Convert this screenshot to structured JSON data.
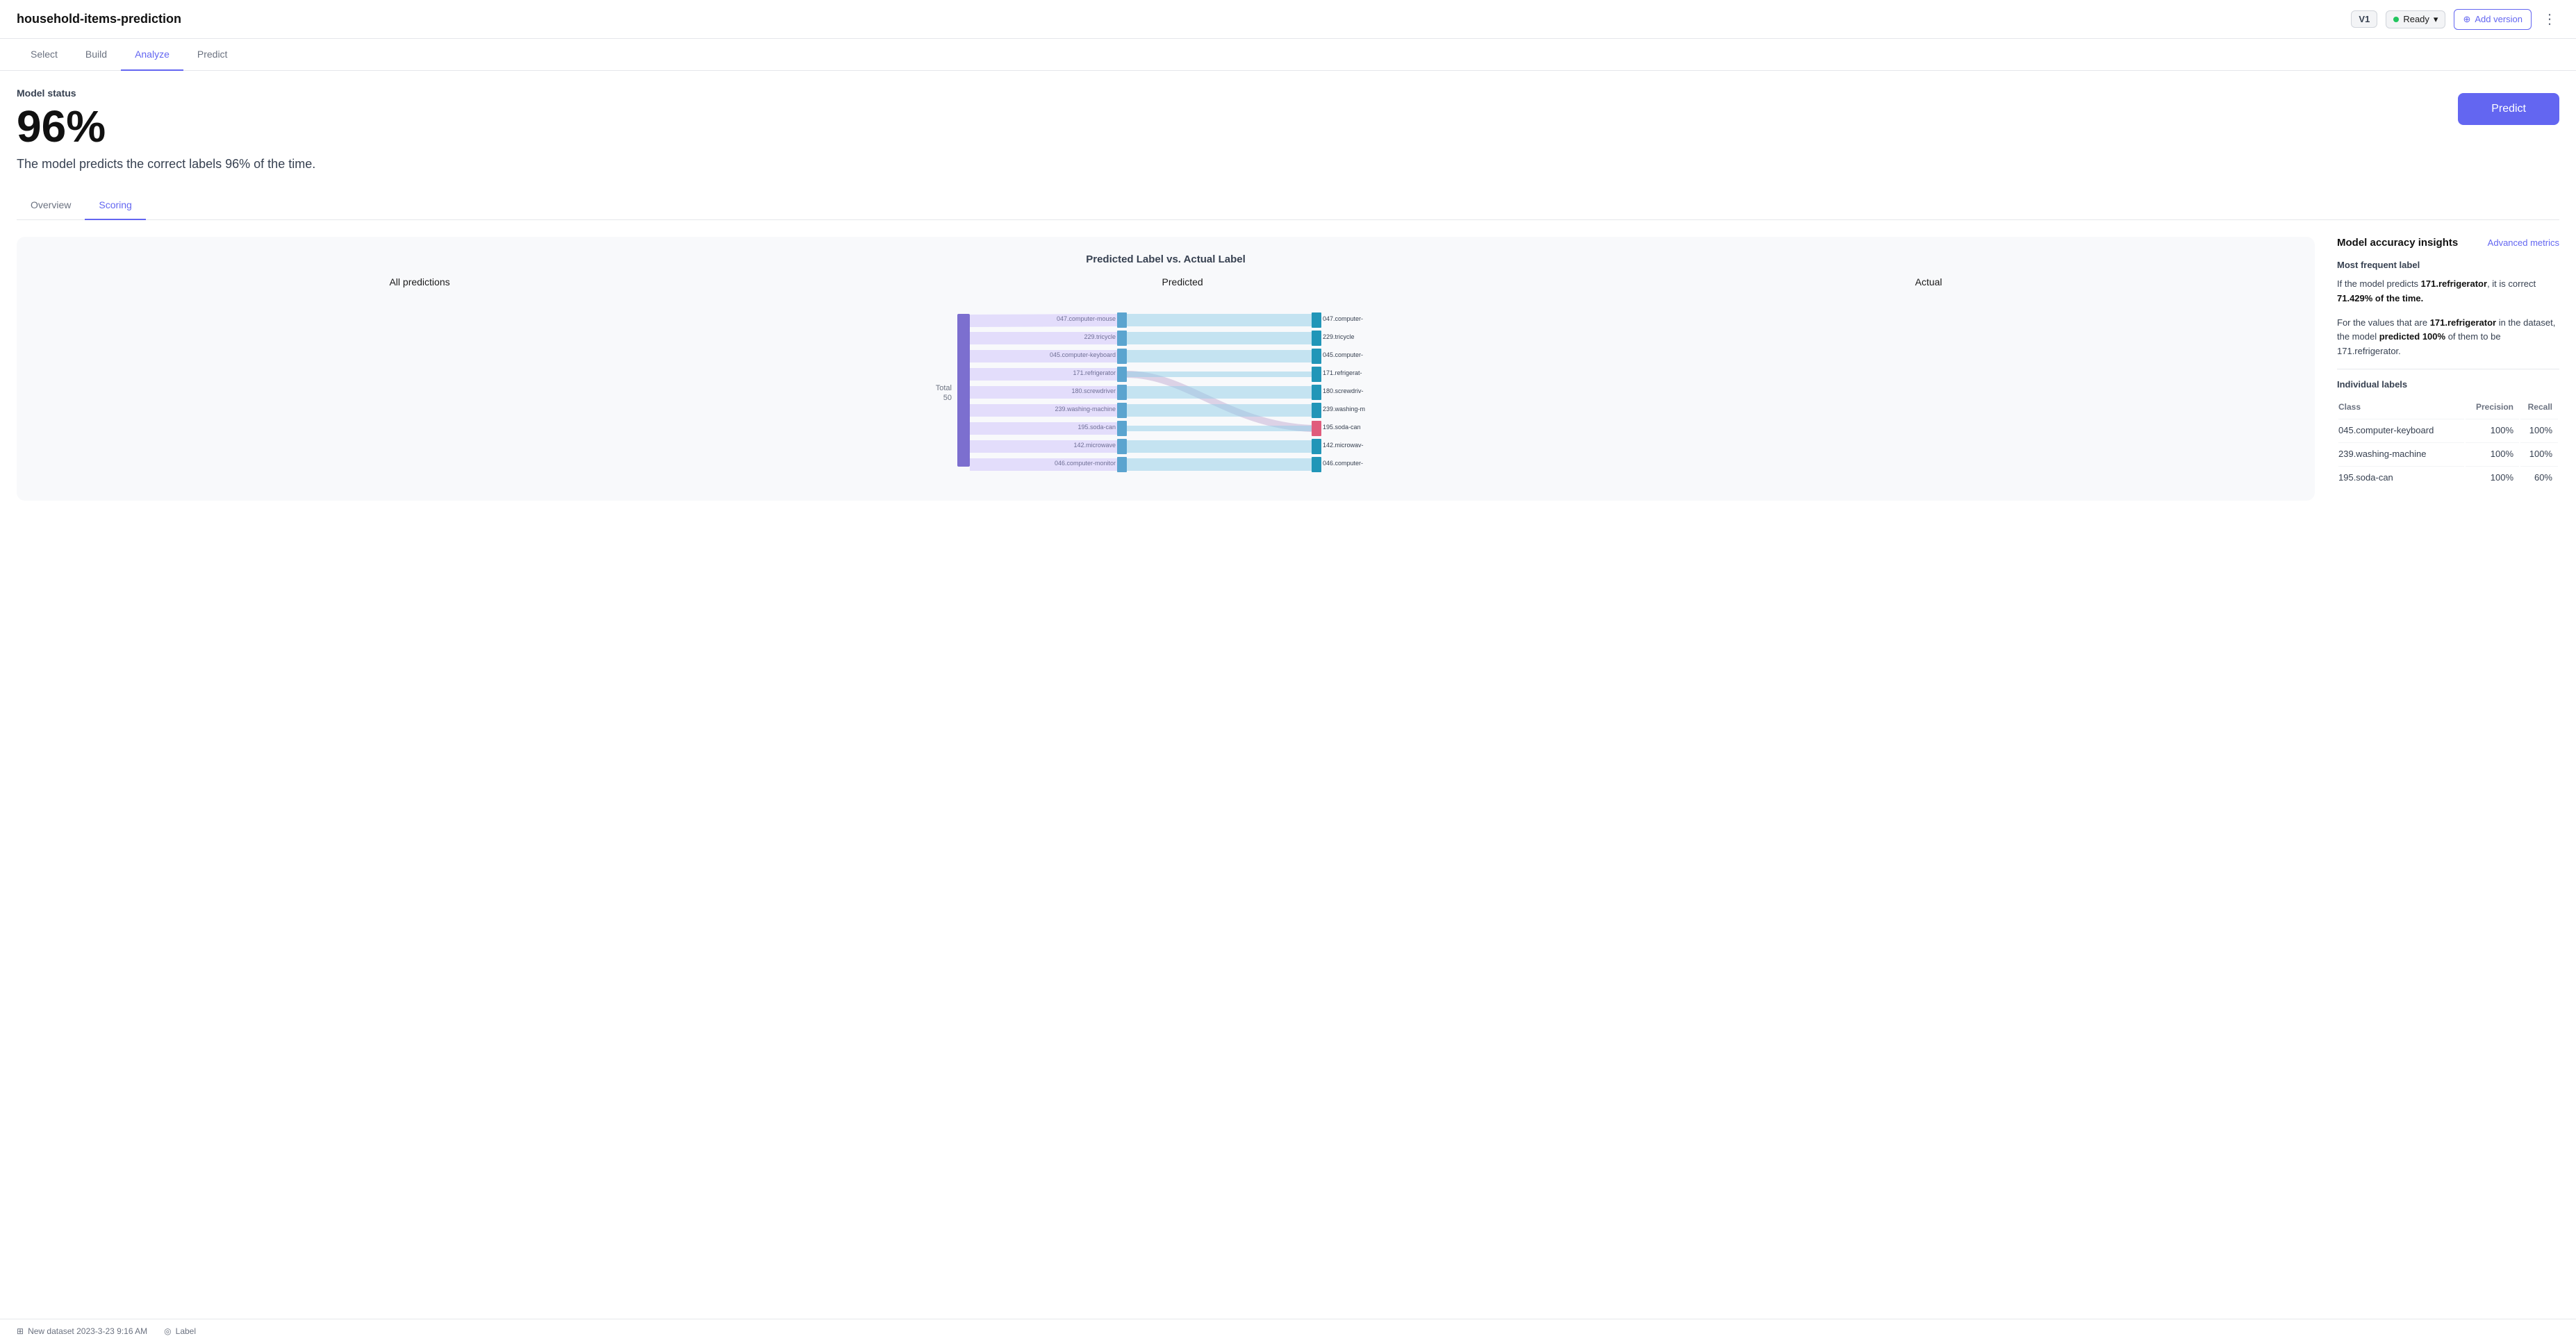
{
  "app": {
    "title": "household-items-prediction"
  },
  "header": {
    "version": "V1",
    "status": "Ready",
    "add_version_label": "Add version",
    "more_icon": "⋮"
  },
  "nav": {
    "tabs": [
      {
        "id": "select",
        "label": "Select"
      },
      {
        "id": "build",
        "label": "Build"
      },
      {
        "id": "analyze",
        "label": "Analyze",
        "active": true
      },
      {
        "id": "predict",
        "label": "Predict"
      }
    ]
  },
  "model_status": {
    "label": "Model status",
    "accuracy": "96%",
    "description": "The model predicts the correct labels 96% of the time."
  },
  "predict_button": "Predict",
  "sub_tabs": [
    {
      "id": "overview",
      "label": "Overview"
    },
    {
      "id": "scoring",
      "label": "Scoring",
      "active": true
    }
  ],
  "chart": {
    "title": "Predicted Label vs. Actual Label",
    "col_all": "All predictions",
    "col_predicted": "Predicted",
    "col_actual": "Actual",
    "total_label": "Total",
    "total_value": "50",
    "rows": [
      {
        "label": "047.computer-mouse",
        "actual": "047.computer-"
      },
      {
        "label": "229.tricycle",
        "actual": "229.tricycle"
      },
      {
        "label": "045.computer-keyboard",
        "actual": "045.computer-"
      },
      {
        "label": "171.refrigerator",
        "actual": "171.refrigerat-"
      },
      {
        "label": "180.screwdriver",
        "actual": "180.screwdriv-"
      },
      {
        "label": "239.washing-machine",
        "actual": "239.washing-m"
      },
      {
        "label": "195.soda-can",
        "actual": "195.soda-can"
      },
      {
        "label": "142.microwave",
        "actual": "142.microwav-"
      },
      {
        "label": "046.computer-monitor",
        "actual": "046.computer-"
      }
    ]
  },
  "insights": {
    "title": "Model accuracy insights",
    "advanced_metrics": "Advanced metrics",
    "most_frequent_label": "Most frequent label",
    "insight1": "If the model predicts 171.refrigerator, it is correct 71.429% of the time.",
    "insight1_bold_class": "171.refrigerator",
    "insight1_bold_pct": "71.429% of the time.",
    "insight2_pre": "For the values that are",
    "insight2_class": "171.refrigerator",
    "insight2_post": "in the dataset, the model",
    "insight2_bold": "predicted 100%",
    "insight2_end": "of them to be 171.refrigerator.",
    "individual_labels": "Individual labels",
    "table_headers": [
      "Class",
      "Precision",
      "Recall"
    ],
    "table_rows": [
      {
        "class": "045.computer-keyboard",
        "precision": "100%",
        "recall": "100%"
      },
      {
        "class": "239.washing-machine",
        "precision": "100%",
        "recall": "100%"
      },
      {
        "class": "195.soda-can",
        "precision": "100%",
        "recall": "60%"
      }
    ]
  },
  "footer": {
    "dataset": "New dataset 2023-3-23 9:16 AM",
    "label": "Label"
  }
}
